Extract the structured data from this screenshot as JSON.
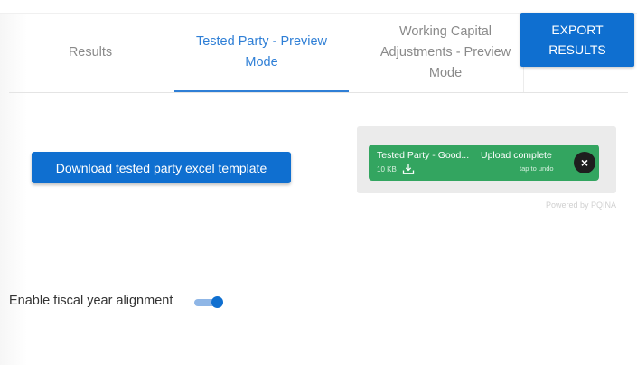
{
  "tabs": [
    {
      "label": "Results",
      "active": false
    },
    {
      "label": "Tested Party - Preview Mode",
      "active": true
    },
    {
      "label": "Working Capital Adjustments - Preview Mode",
      "active": false
    }
  ],
  "toolbar": {
    "export_label": "EXPORT RESULTS"
  },
  "main": {
    "download_label": "Download tested party excel template"
  },
  "upload": {
    "file_name": "Tested Party - Good...",
    "file_size": "10 KB",
    "status": "Upload complete",
    "undo_hint": "tap to undo",
    "close_symbol": "×",
    "powered_by": "Powered by PQINA"
  },
  "settings": {
    "fiscal_alignment_label": "Enable fiscal year alignment",
    "fiscal_alignment_enabled": true
  },
  "colors": {
    "accent": "#0f6fd0",
    "upload_success": "#33a560",
    "close_button": "#1e1e1e"
  },
  "icons": {
    "download": "download-icon",
    "close": "close-icon"
  }
}
